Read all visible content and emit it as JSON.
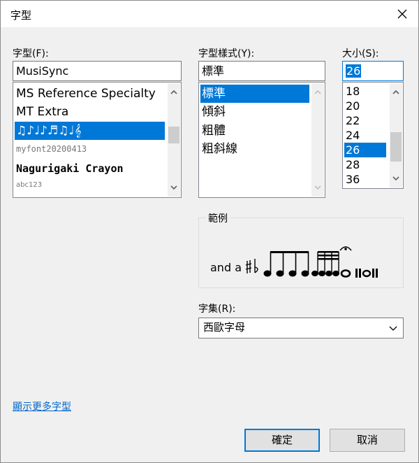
{
  "window": {
    "title": "字型"
  },
  "font": {
    "label": "字型(F):",
    "value": "MusiSync",
    "items": [
      "MS Reference Specialty",
      "MT Extra",
      "♫♪♩♪♬♫♩𝄞",
      "myfont20200413",
      "Nagurigaki Crayon",
      "abc123"
    ],
    "selected_index": 2
  },
  "style": {
    "label": "字型樣式(Y):",
    "value": "標準",
    "items": [
      "標準",
      "傾斜",
      "粗體",
      "粗斜線"
    ],
    "selected_index": 0
  },
  "size": {
    "label": "大小(S):",
    "value": "26",
    "items": [
      "18",
      "20",
      "22",
      "24",
      "26",
      "28",
      "36"
    ],
    "selected_index": 4
  },
  "sample": {
    "group_label": "範例",
    "text": "and a"
  },
  "script": {
    "label": "字集(R):",
    "value": "西歐字母"
  },
  "more_fonts_link": "顯示更多字型",
  "buttons": {
    "ok": "確定",
    "cancel": "取消"
  }
}
